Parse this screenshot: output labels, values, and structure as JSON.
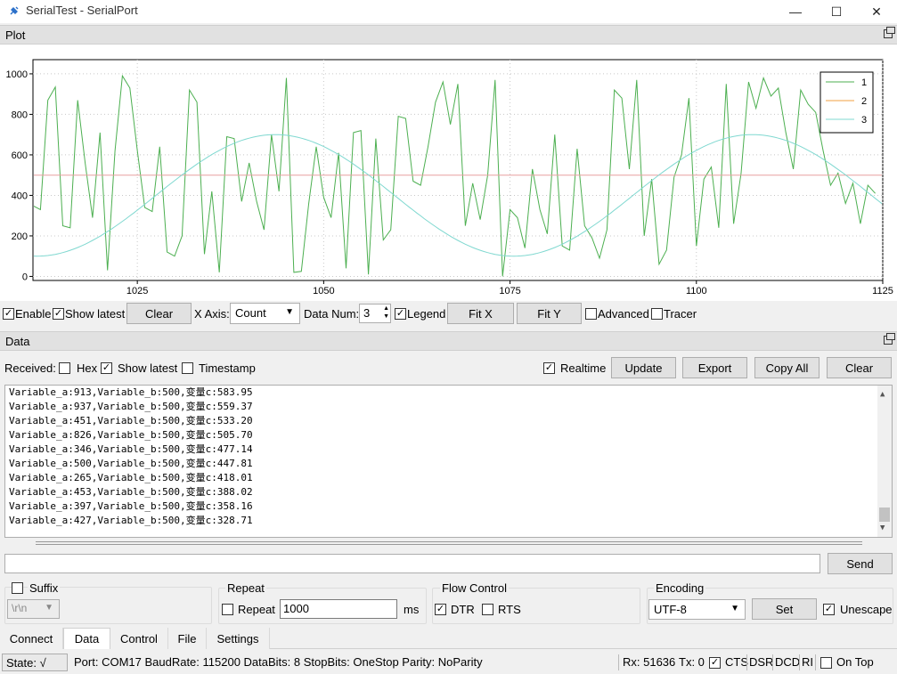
{
  "window": {
    "title": "SerialTest - SerialPort",
    "icon": "plug-icon",
    "minimize": "—",
    "maximize": "☐",
    "close": "✕"
  },
  "plot_panel": {
    "title": "Plot",
    "controls": {
      "enable_label": "Enable",
      "enable_checked": true,
      "show_latest_label": "Show latest",
      "show_latest_checked": true,
      "clear_label": "Clear",
      "x_axis_label": "X Axis:",
      "x_axis_value": "Count",
      "data_num_label": "Data Num:",
      "data_num_value": "3",
      "legend_label": "Legend",
      "legend_checked": true,
      "fit_x_label": "Fit X",
      "fit_y_label": "Fit Y",
      "advanced_label": "Advanced",
      "advanced_checked": false,
      "tracer_label": "Tracer",
      "tracer_checked": false
    }
  },
  "chart_data": {
    "type": "line",
    "title": "",
    "xlabel": "",
    "ylabel": "",
    "xlim": [
      1011,
      1125
    ],
    "ylim": [
      -20,
      1070
    ],
    "x_ticks": [
      "1025",
      "1050",
      "1075",
      "1100",
      "1125"
    ],
    "x_tick_values": [
      1025,
      1050,
      1075,
      1100,
      1125
    ],
    "y_ticks": [
      "0",
      "200",
      "400",
      "600",
      "800",
      "1000"
    ],
    "y_tick_values": [
      0,
      200,
      400,
      600,
      800,
      1000
    ],
    "grid": true,
    "legend_position": "top-right",
    "series": [
      {
        "name": "1",
        "color": "#4caf50",
        "x_start": 1011,
        "values": [
          349,
          330,
          870,
          935,
          250,
          240,
          870,
          560,
          290,
          710,
          30,
          620,
          990,
          930,
          620,
          340,
          320,
          640,
          120,
          100,
          200,
          920,
          860,
          110,
          420,
          20,
          690,
          680,
          370,
          560,
          370,
          230,
          700,
          420,
          980,
          20,
          25,
          360,
          640,
          390,
          290,
          610,
          40,
          710,
          720,
          10,
          680,
          180,
          230,
          790,
          780,
          470,
          450,
          640,
          860,
          960,
          750,
          950,
          250,
          460,
          280,
          500,
          970,
          0,
          330,
          290,
          140,
          530,
          330,
          210,
          700,
          150,
          130,
          630,
          250,
          190,
          90,
          230,
          920,
          880,
          530,
          970,
          200,
          480,
          60,
          130,
          490,
          600,
          880,
          150,
          480,
          540,
          240,
          950,
          260,
          510,
          960,
          830,
          980,
          890,
          930,
          710,
          530,
          920,
          850,
          810,
          620,
          450,
          510,
          360,
          460,
          260,
          450,
          410
        ]
      },
      {
        "name": "2",
        "color": "#f0a040",
        "x_start": 1011,
        "constant": 500
      },
      {
        "name": "3",
        "color": "#7fd8d0",
        "x_start": 1011,
        "sine": {
          "center": 400,
          "amplitude": 300,
          "period": 64,
          "peak_x": 1043.5
        }
      }
    ]
  },
  "data_panel": {
    "title": "Data",
    "received_label": "Received:",
    "hex_label": "Hex",
    "hex_checked": false,
    "show_latest_label": "Show latest",
    "show_latest_checked": true,
    "timestamp_label": "Timestamp",
    "timestamp_checked": false,
    "realtime_label": "Realtime",
    "realtime_checked": true,
    "update_label": "Update",
    "export_label": "Export",
    "copy_all_label": "Copy All",
    "clear_label": "Clear",
    "lines": [
      "Variable_a:913,Variable_b:500,变量c:583.95",
      "Variable_a:937,Variable_b:500,变量c:559.37",
      "Variable_a:451,Variable_b:500,变量c:533.20",
      "Variable_a:826,Variable_b:500,变量c:505.70",
      "Variable_a:346,Variable_b:500,变量c:477.14",
      "Variable_a:500,Variable_b:500,变量c:447.81",
      "Variable_a:265,Variable_b:500,变量c:418.01",
      "Variable_a:453,Variable_b:500,变量c:388.02",
      "Variable_a:397,Variable_b:500,变量c:358.16",
      "Variable_a:427,Variable_b:500,变量c:328.71"
    ]
  },
  "send": {
    "value": "",
    "button_label": "Send",
    "suffix_label": "Suffix",
    "suffix_checked": false,
    "suffix_value": "\\r\\n",
    "repeat_group_label": "Repeat",
    "repeat_label": "Repeat",
    "repeat_checked": false,
    "repeat_value": "1000",
    "repeat_unit": "ms",
    "flow_control_label": "Flow Control",
    "dtr_label": "DTR",
    "dtr_checked": true,
    "rts_label": "RTS",
    "rts_checked": false,
    "encoding_label": "Encoding",
    "encoding_value": "UTF-8",
    "set_label": "Set",
    "unescape_label": "Unescape",
    "unescape_checked": true
  },
  "tabs": [
    {
      "label": "Connect",
      "active": false
    },
    {
      "label": "Data",
      "active": true
    },
    {
      "label": "Control",
      "active": false
    },
    {
      "label": "File",
      "active": false
    },
    {
      "label": "Settings",
      "active": false
    }
  ],
  "status": {
    "state": "State: √",
    "port_info": "Port: COM17 BaudRate: 115200 DataBits: 8 StopBits: OneStop Parity: NoParity",
    "rx": "Rx: 51636",
    "tx": "Tx: 0",
    "cts_label": "CTS",
    "cts_checked": true,
    "dsr_label": "DSR",
    "dcd_label": "DCD",
    "ri_label": "RI",
    "on_top_label": "On Top",
    "on_top_checked": false
  }
}
